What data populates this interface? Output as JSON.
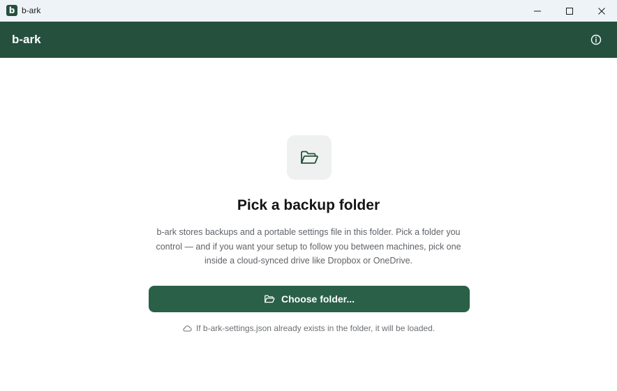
{
  "window": {
    "icon_letter": "b",
    "title": "b-ark"
  },
  "header": {
    "brand": "b-ark"
  },
  "main": {
    "heading": "Pick a backup folder",
    "description": "b-ark stores backups and a portable settings file in this folder. Pick a folder you control — and if you want your setup to follow you between machines, pick one inside a cloud-synced drive like Dropbox or OneDrive.",
    "choose_button_label": "Choose folder...",
    "hint": "If b-ark-settings.json already exists in the folder, it will be loaded."
  },
  "icons": {
    "app": "b-logo-icon",
    "minimize": "minimize-icon",
    "maximize": "maximize-icon",
    "close": "close-icon",
    "info": "info-icon",
    "folder_tile": "folder-open-icon",
    "button": "folder-open-icon",
    "hint": "cloud-icon"
  },
  "colors": {
    "header_bg": "#24503d",
    "button_bg": "#2a6048",
    "titlebar_bg": "#eef3f8",
    "icon_tile_bg": "#eef1ef"
  }
}
